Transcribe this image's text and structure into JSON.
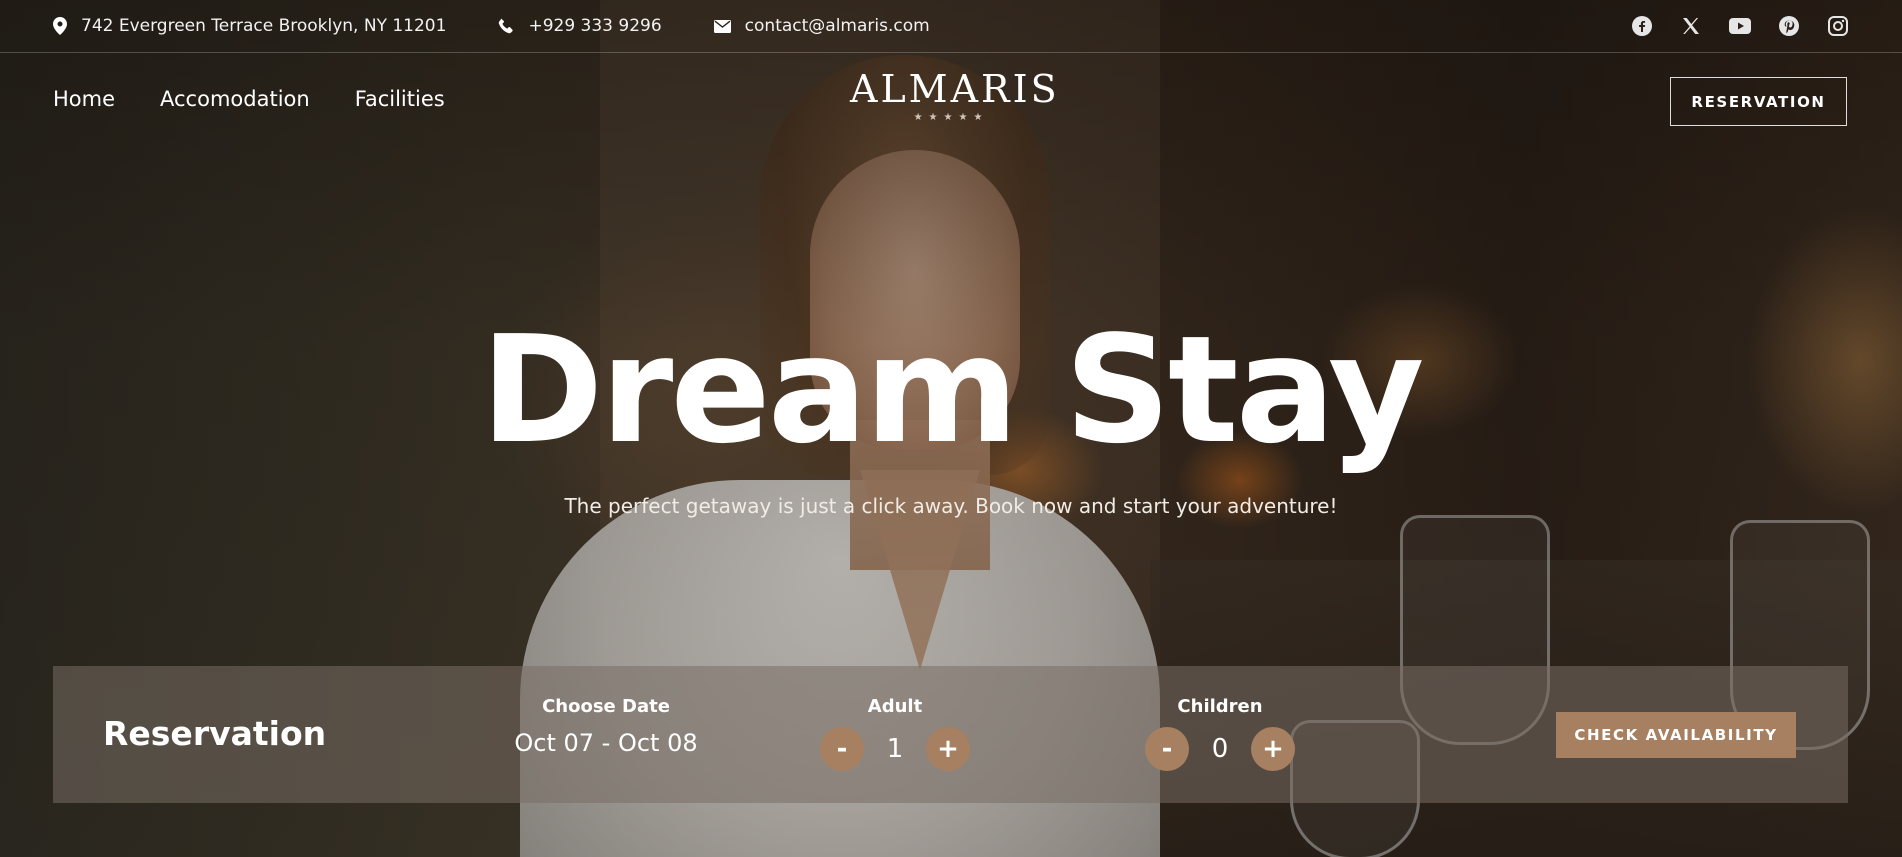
{
  "topbar": {
    "address": "742 Evergreen Terrace Brooklyn, NY 11201",
    "phone": "+929 333 9296",
    "email": "contact@almaris.com",
    "social_icons": [
      "facebook-icon",
      "x-icon",
      "youtube-icon",
      "pinterest-icon",
      "instagram-icon"
    ]
  },
  "nav": {
    "items": [
      {
        "label": "Home"
      },
      {
        "label": "Accomodation"
      },
      {
        "label": "Facilities"
      }
    ],
    "logo": "ALMARIS",
    "logo_stars": "★★★★★",
    "reservation_button": "RESERVATION"
  },
  "hero": {
    "title": "Dream Stay",
    "subtitle": "The perfect getaway is just a click away. Book now and start your adventure!"
  },
  "reservation": {
    "title": "Reservation",
    "date_label": "Choose Date",
    "date_value": "Oct 07 - Oct 08",
    "adult_label": "Adult",
    "adult_value": "1",
    "children_label": "Children",
    "children_value": "0",
    "minus": "-",
    "plus": "+",
    "check_button": "CHECK AVAILABILITY"
  },
  "colors": {
    "accent": "#a68061",
    "panel": "rgba(120,110,100,0.55)"
  }
}
